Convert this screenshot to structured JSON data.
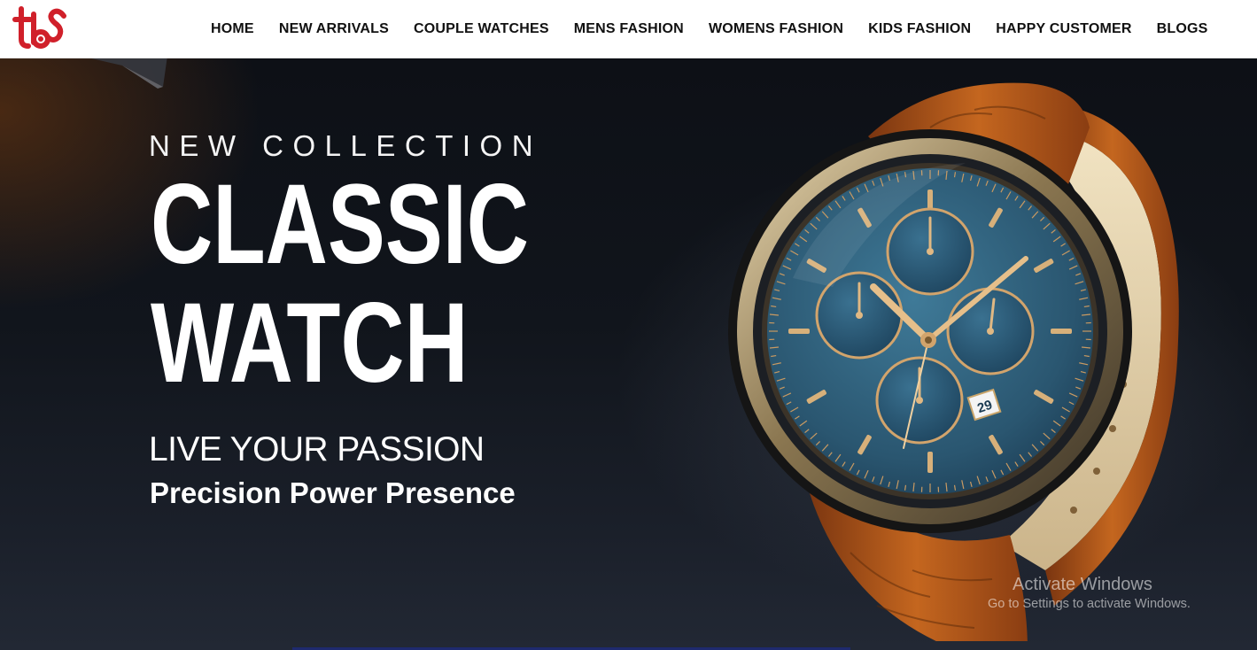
{
  "brand": {
    "logo_icon": "tbos-logo",
    "accent_color": "#d0202a"
  },
  "nav": {
    "items": [
      {
        "label": "HOME"
      },
      {
        "label": "NEW ARRIVALS"
      },
      {
        "label": "COUPLE WATCHES"
      },
      {
        "label": "MENS FASHION"
      },
      {
        "label": "WOMENS FASHION"
      },
      {
        "label": "KIDS FASHION"
      },
      {
        "label": "HAPPY CUSTOMER"
      },
      {
        "label": "BLOGS"
      }
    ]
  },
  "hero": {
    "eyebrow": "NEW COLLECTION",
    "headline_line1": "CLASSIC",
    "headline_line2": "WATCH",
    "tagline": "LIVE YOUR PASSION",
    "subtagline": "Precision Power Presence",
    "image_icon": "chronograph-watch-image",
    "dial_color": "#2f5f7a",
    "strap_color": "#b4581d",
    "date_window": "29"
  },
  "os_watermark": {
    "title": "Activate Windows",
    "subtitle": "Go to Settings to activate Windows."
  }
}
